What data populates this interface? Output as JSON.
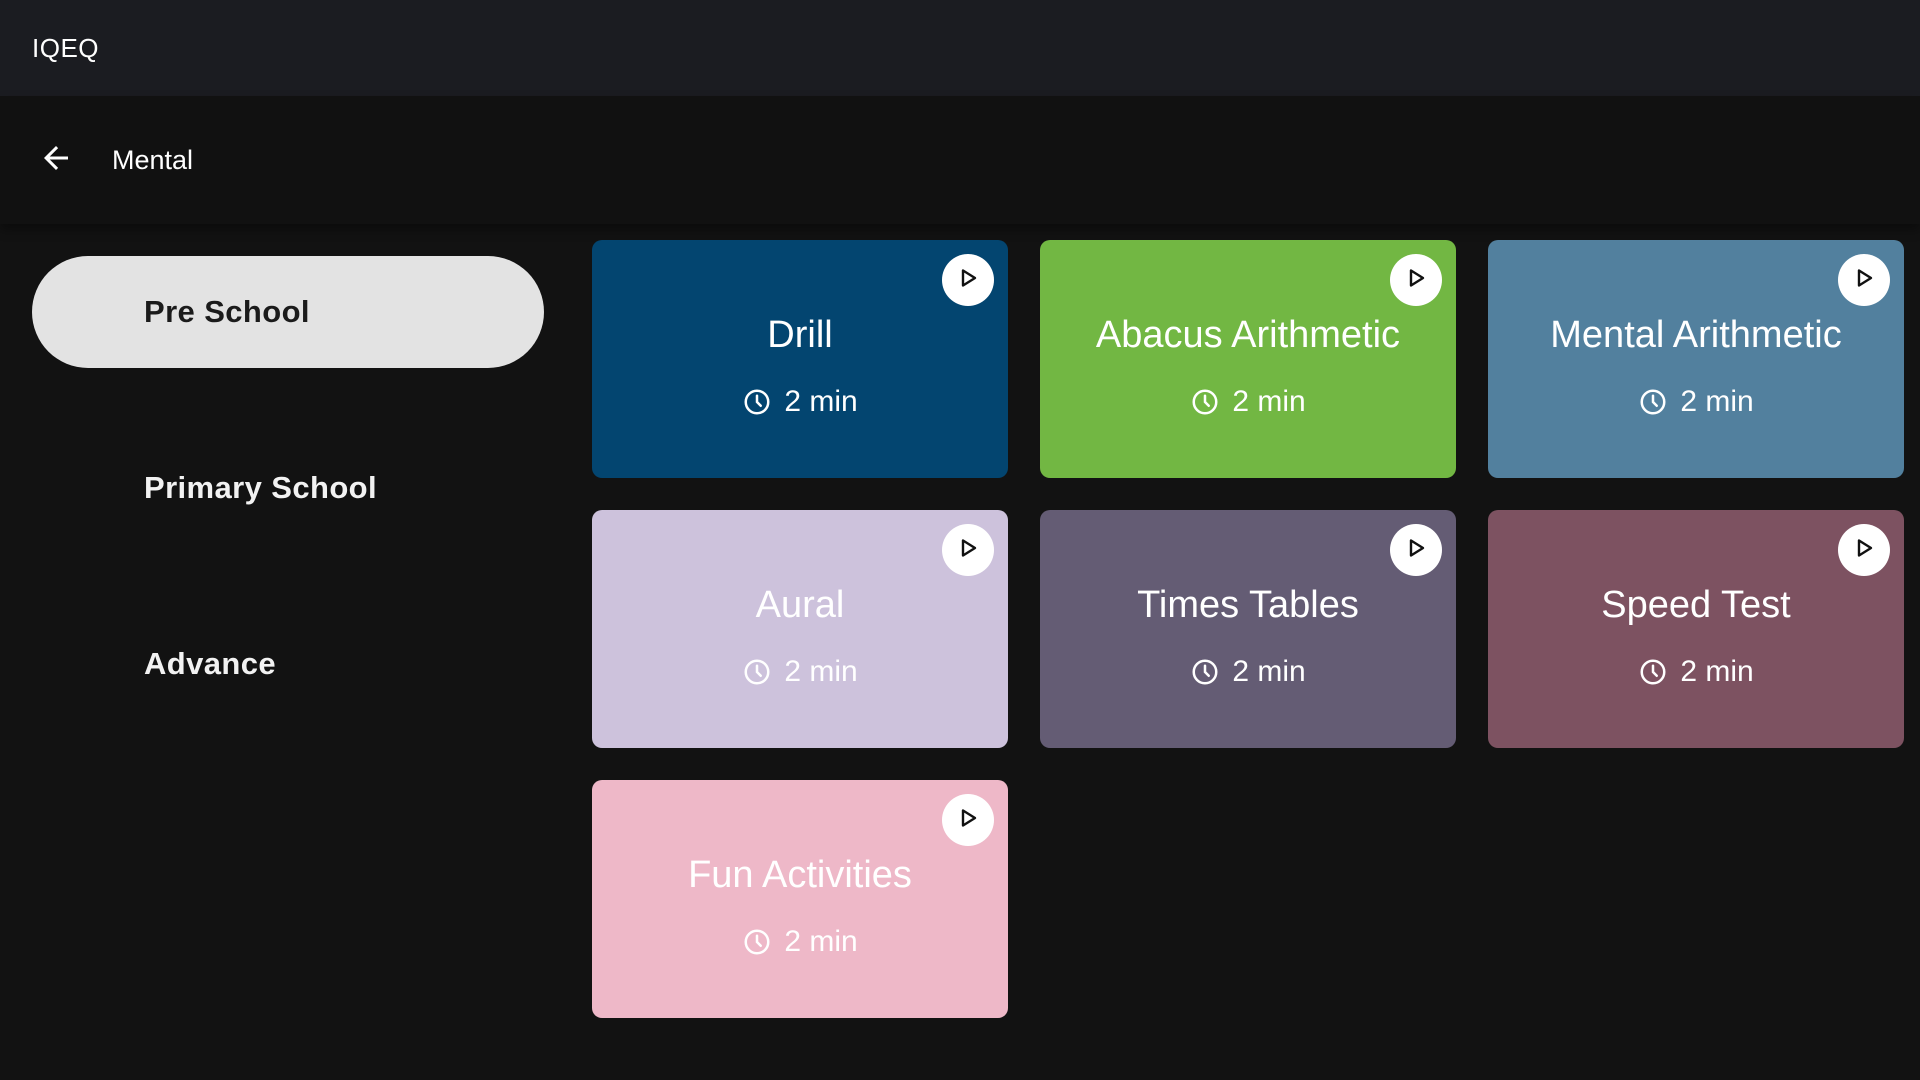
{
  "app": {
    "title": "IQEQ"
  },
  "header": {
    "title": "Mental",
    "back_icon": "arrow-left-icon"
  },
  "sidebar": {
    "items": [
      {
        "label": "Pre School",
        "active": true
      },
      {
        "label": "Primary School",
        "active": false
      },
      {
        "label": "Advance",
        "active": false
      }
    ]
  },
  "cards": [
    {
      "title": "Drill",
      "duration": "2 min",
      "color": "#034570",
      "text_color": "#ffffff"
    },
    {
      "title": "Abacus Arithmetic",
      "duration": "2 min",
      "color": "#72b743",
      "text_color": "#ffffff"
    },
    {
      "title": "Mental Arithmetic",
      "duration": "2 min",
      "color": "#52809e",
      "text_color": "#ffffff"
    },
    {
      "title": "Aural",
      "duration": "2 min",
      "color": "#cdc2dc",
      "text_color": "#ffffff"
    },
    {
      "title": "Times Tables",
      "duration": "2 min",
      "color": "#645c74",
      "text_color": "#ffffff"
    },
    {
      "title": "Speed Test",
      "duration": "2 min",
      "color": "#7d5261",
      "text_color": "#ffffff"
    },
    {
      "title": "Fun Activities",
      "duration": "2 min",
      "color": "#eeb8c8",
      "text_color": "#ffffff"
    }
  ],
  "icons": {
    "play": "play-icon",
    "clock": "clock-icon"
  }
}
